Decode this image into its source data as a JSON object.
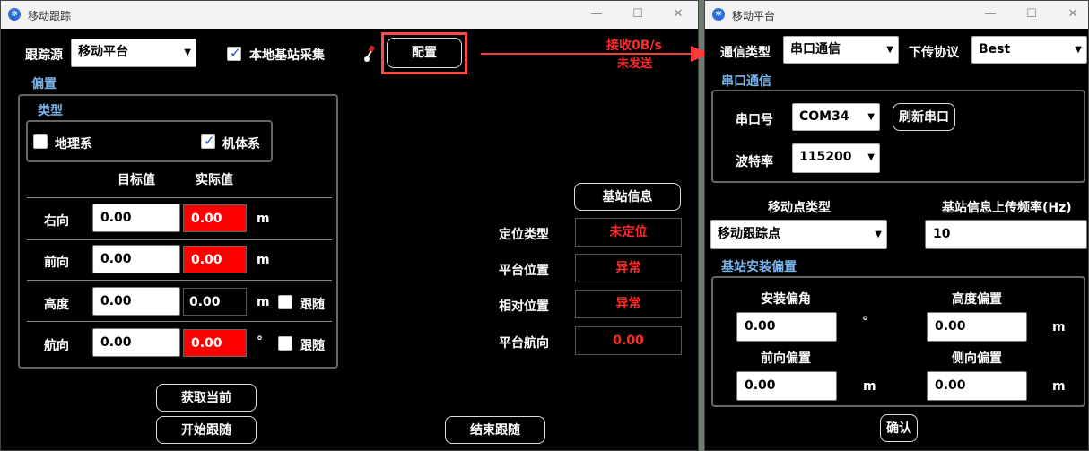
{
  "left_window": {
    "title": "移动跟踪",
    "source_label": "跟踪源",
    "source_value": "移动平台",
    "local_base_label": "本地基站采集",
    "local_base_checked": true,
    "config_button": "配置",
    "offset_section": "偏置",
    "type_section": "类型",
    "geo_label": "地理系",
    "geo_checked": false,
    "body_label": "机体系",
    "body_checked": true,
    "col_target": "目标值",
    "col_actual": "实际值",
    "rows": [
      {
        "label": "右向",
        "target": "0.00",
        "actual": "0.00",
        "unit": "m"
      },
      {
        "label": "前向",
        "target": "0.00",
        "actual": "0.00",
        "unit": "m"
      },
      {
        "label": "高度",
        "target": "0.00",
        "actual": "0.00",
        "unit": "m",
        "follow": "跟随"
      },
      {
        "label": "航向",
        "target": "0.00",
        "actual": "0.00",
        "unit": "°",
        "follow": "跟随"
      }
    ],
    "base_info_button": "基站信息",
    "status": [
      {
        "label": "定位类型",
        "value": "未定位"
      },
      {
        "label": "平台位置",
        "value": "异常"
      },
      {
        "label": "相对位置",
        "value": "异常"
      },
      {
        "label": "平台航向",
        "value": "0.00"
      }
    ],
    "get_current_button": "获取当前",
    "start_follow_button": "开始跟随",
    "end_follow_button": "结束跟随"
  },
  "annotation": {
    "line1": "接收0B/s",
    "line2": "未发送",
    "color": "#ff2a2a"
  },
  "right_window": {
    "title": "移动平台",
    "comm_type_label": "通信类型",
    "comm_type_value": "串口通信",
    "downlink_label": "下传协议",
    "downlink_value": "Best",
    "serial_section": "串口通信",
    "port_label": "串口号",
    "port_value": "COM34",
    "refresh_button": "刷新串口",
    "baud_label": "波特率",
    "baud_value": "115200",
    "mobile_type_label": "移动点类型",
    "mobile_type_value": "移动跟踪点",
    "upload_freq_label": "基站信息上传频率(Hz)",
    "upload_freq_value": "10",
    "install_section": "基站安装偏置",
    "install_angle_label": "安装偏角",
    "install_angle_value": "0.00",
    "install_angle_unit": "°",
    "height_offset_label": "高度偏置",
    "height_offset_value": "0.00",
    "height_offset_unit": "m",
    "front_offset_label": "前向偏置",
    "front_offset_value": "0.00",
    "front_offset_unit": "m",
    "side_offset_label": "侧向偏置",
    "side_offset_value": "0.00",
    "side_offset_unit": "m",
    "confirm_button": "确认"
  }
}
